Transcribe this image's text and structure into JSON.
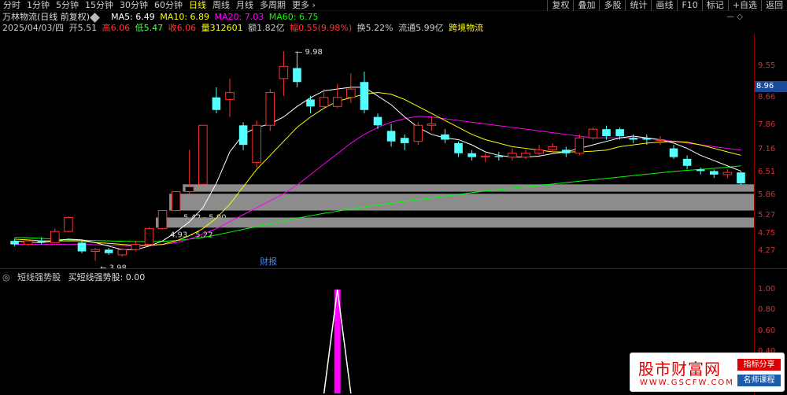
{
  "toolbar": {
    "periods": [
      "分时",
      "1分钟",
      "5分钟",
      "15分钟",
      "30分钟",
      "60分钟",
      "日线",
      "周线",
      "月线",
      "多周期",
      "更多"
    ],
    "active_period": "日线",
    "buttons": [
      "复权",
      "叠加",
      "多股",
      "统计",
      "画线",
      "F10",
      "标记",
      "+自选",
      "返回"
    ]
  },
  "stock": {
    "name": "万林物流(日线 前复权)",
    "ma5": "MA5: 6.49",
    "ma10": "MA10: 6.89",
    "ma20": "MA20: 7.03",
    "ma60": "MA60: 6.75",
    "date": "2025/04/03/四",
    "open": "开5.51",
    "high": "高6.06",
    "low": "低5.47",
    "close": "收6.06",
    "volume": "量312601",
    "amount": "额1.82亿",
    "change": "幅0.55(9.98%)",
    "turnover": "换5.22%",
    "float_cap": "流通5.99亿",
    "concept": "跨境物流"
  },
  "colors": {
    "up": "#ff3232",
    "down": "#54ffff",
    "ma5": "#ffffff",
    "ma10": "#ffff00",
    "ma20": "#ff00ff",
    "ma60": "#00ff00",
    "axis": "#cc3333",
    "gray_band": "#8c8c8c",
    "indicator_bar": "#ff00ff",
    "indicator_line": "#ffffff",
    "current_price_bg": "#1a4a9a"
  },
  "price_axis": {
    "ticks": [
      "9.55",
      "8.66",
      "7.86",
      "7.16",
      "6.51",
      "5.86",
      "5.27",
      "4.75",
      "4.27"
    ],
    "current": "8.96"
  },
  "annotations": {
    "high_label": "9.98",
    "low_label": "3.98",
    "event_label": "财报",
    "band1": "5.96 - 6.17",
    "band2": "5.42 - 5.90",
    "band3": "4.93 - 5.22"
  },
  "indicator": {
    "name": "短线强势股",
    "formula": "买短线强势股: 0.00",
    "ticks": [
      "1.00",
      "0.80",
      "0.60",
      "0.40",
      "0.20"
    ]
  },
  "watermark": {
    "title": "股市财富网",
    "url": "WWW.GSCFW.COM",
    "badge1": "指标分享",
    "badge2": "名师课程"
  },
  "chart_data": {
    "type": "candlestick",
    "price_range": [
      3.9,
      10.3
    ],
    "candles": [
      {
        "o": 4.55,
        "c": 4.45,
        "h": 4.62,
        "l": 4.4
      },
      {
        "o": 4.45,
        "c": 4.55,
        "h": 4.6,
        "l": 4.4
      },
      {
        "o": 4.55,
        "c": 4.5,
        "h": 4.65,
        "l": 4.45
      },
      {
        "o": 4.5,
        "c": 4.82,
        "h": 4.9,
        "l": 4.48
      },
      {
        "o": 4.82,
        "c": 5.22,
        "h": 5.25,
        "l": 4.8
      },
      {
        "o": 4.5,
        "c": 4.25,
        "h": 4.55,
        "l": 4.2
      },
      {
        "o": 4.25,
        "c": 4.3,
        "h": 4.35,
        "l": 3.98
      },
      {
        "o": 4.3,
        "c": 4.2,
        "h": 4.35,
        "l": 4.15
      },
      {
        "o": 4.15,
        "c": 4.3,
        "h": 4.35,
        "l": 4.1
      },
      {
        "o": 4.3,
        "c": 4.45,
        "h": 4.55,
        "l": 4.25
      },
      {
        "o": 4.45,
        "c": 4.9,
        "h": 4.95,
        "l": 4.4
      },
      {
        "o": 4.9,
        "c": 5.42,
        "h": 5.42,
        "l": 4.88
      },
      {
        "o": 5.42,
        "c": 5.96,
        "h": 5.96,
        "l": 5.4
      },
      {
        "o": 5.96,
        "c": 6.1,
        "h": 7.16,
        "l": 5.9
      },
      {
        "o": 6.17,
        "c": 7.86,
        "h": 7.86,
        "l": 6.15
      },
      {
        "o": 8.66,
        "c": 8.3,
        "h": 8.95,
        "l": 8.2
      },
      {
        "o": 8.6,
        "c": 8.8,
        "h": 9.2,
        "l": 8.1
      },
      {
        "o": 7.86,
        "c": 7.3,
        "h": 7.95,
        "l": 7.15
      },
      {
        "o": 6.8,
        "c": 7.86,
        "h": 8.0,
        "l": 6.65
      },
      {
        "o": 7.86,
        "c": 8.8,
        "h": 8.9,
        "l": 7.7
      },
      {
        "o": 9.2,
        "c": 9.55,
        "h": 9.98,
        "l": 8.7
      },
      {
        "o": 9.5,
        "c": 9.1,
        "h": 9.98,
        "l": 8.95
      },
      {
        "o": 8.6,
        "c": 8.4,
        "h": 8.7,
        "l": 8.2
      },
      {
        "o": 8.4,
        "c": 8.66,
        "h": 8.9,
        "l": 8.35
      },
      {
        "o": 8.4,
        "c": 8.66,
        "h": 9.05,
        "l": 8.35
      },
      {
        "o": 8.66,
        "c": 8.9,
        "h": 9.35,
        "l": 8.5
      },
      {
        "o": 9.1,
        "c": 8.3,
        "h": 9.4,
        "l": 8.2
      },
      {
        "o": 8.1,
        "c": 7.86,
        "h": 8.2,
        "l": 7.75
      },
      {
        "o": 7.7,
        "c": 7.4,
        "h": 7.9,
        "l": 7.25
      },
      {
        "o": 7.5,
        "c": 7.35,
        "h": 7.6,
        "l": 7.15
      },
      {
        "o": 7.4,
        "c": 7.86,
        "h": 7.95,
        "l": 7.3
      },
      {
        "o": 7.86,
        "c": 7.9,
        "h": 8.1,
        "l": 7.7
      },
      {
        "o": 7.6,
        "c": 7.45,
        "h": 7.75,
        "l": 7.35
      },
      {
        "o": 7.35,
        "c": 7.06,
        "h": 7.4,
        "l": 6.95
      },
      {
        "o": 7.06,
        "c": 6.95,
        "h": 7.15,
        "l": 6.85
      },
      {
        "o": 6.95,
        "c": 6.98,
        "h": 7.06,
        "l": 6.8
      },
      {
        "o": 6.98,
        "c": 6.95,
        "h": 7.1,
        "l": 6.85
      },
      {
        "o": 6.95,
        "c": 7.06,
        "h": 7.2,
        "l": 6.85
      },
      {
        "o": 6.95,
        "c": 7.06,
        "h": 7.16,
        "l": 6.9
      },
      {
        "o": 7.06,
        "c": 7.16,
        "h": 7.3,
        "l": 7.0
      },
      {
        "o": 7.16,
        "c": 7.25,
        "h": 7.35,
        "l": 7.1
      },
      {
        "o": 7.16,
        "c": 7.06,
        "h": 7.25,
        "l": 6.95
      },
      {
        "o": 7.06,
        "c": 7.5,
        "h": 7.6,
        "l": 7.0
      },
      {
        "o": 7.5,
        "c": 7.75,
        "h": 7.8,
        "l": 7.45
      },
      {
        "o": 7.75,
        "c": 7.55,
        "h": 7.85,
        "l": 7.45
      },
      {
        "o": 7.75,
        "c": 7.55,
        "h": 7.8,
        "l": 7.45
      },
      {
        "o": 7.5,
        "c": 7.45,
        "h": 7.6,
        "l": 7.35
      },
      {
        "o": 7.5,
        "c": 7.45,
        "h": 7.6,
        "l": 7.3
      },
      {
        "o": 7.45,
        "c": 7.45,
        "h": 7.55,
        "l": 7.3
      },
      {
        "o": 7.2,
        "c": 6.95,
        "h": 7.3,
        "l": 6.9
      },
      {
        "o": 6.9,
        "c": 6.7,
        "h": 7.0,
        "l": 6.6
      },
      {
        "o": 6.6,
        "c": 6.55,
        "h": 6.65,
        "l": 6.45
      },
      {
        "o": 6.55,
        "c": 6.45,
        "h": 6.6,
        "l": 6.35
      },
      {
        "o": 6.45,
        "c": 6.51,
        "h": 6.6,
        "l": 6.35
      },
      {
        "o": 6.51,
        "c": 6.2,
        "h": 6.55,
        "l": 6.15
      }
    ],
    "ma5": [
      4.55,
      4.52,
      4.5,
      4.55,
      4.6,
      4.58,
      4.5,
      4.4,
      4.3,
      4.3,
      4.4,
      4.55,
      4.8,
      5.1,
      5.5,
      6.2,
      7.1,
      7.6,
      7.8,
      7.9,
      8.1,
      8.4,
      8.65,
      8.85,
      8.9,
      8.95,
      8.95,
      8.7,
      8.45,
      8.1,
      7.8,
      7.6,
      7.5,
      7.45,
      7.3,
      7.1,
      7.0,
      6.95,
      6.95,
      6.98,
      7.05,
      7.1,
      7.2,
      7.3,
      7.4,
      7.5,
      7.55,
      7.5,
      7.45,
      7.35,
      7.2,
      7.0,
      6.85,
      6.7,
      6.55
    ],
    "ma10": [
      4.6,
      4.58,
      4.55,
      4.55,
      4.55,
      4.55,
      4.5,
      4.48,
      4.45,
      4.42,
      4.42,
      4.45,
      4.55,
      4.7,
      4.9,
      5.2,
      5.6,
      6.1,
      6.6,
      7.0,
      7.4,
      7.8,
      8.1,
      8.35,
      8.55,
      8.65,
      8.75,
      8.8,
      8.75,
      8.6,
      8.4,
      8.2,
      8.0,
      7.8,
      7.6,
      7.45,
      7.35,
      7.25,
      7.2,
      7.15,
      7.1,
      7.1,
      7.1,
      7.12,
      7.15,
      7.25,
      7.3,
      7.35,
      7.38,
      7.4,
      7.38,
      7.3,
      7.2,
      7.1,
      7.0
    ],
    "ma20": [
      4.45,
      4.45,
      4.45,
      4.45,
      4.45,
      4.45,
      4.44,
      4.43,
      4.42,
      4.41,
      4.42,
      4.45,
      4.5,
      4.6,
      4.75,
      4.9,
      5.1,
      5.3,
      5.5,
      5.7,
      5.9,
      6.15,
      6.45,
      6.75,
      7.05,
      7.35,
      7.6,
      7.8,
      7.95,
      8.05,
      8.12,
      8.1,
      8.05,
      8.0,
      7.95,
      7.9,
      7.85,
      7.8,
      7.75,
      7.7,
      7.65,
      7.6,
      7.55,
      7.5,
      7.5,
      7.5,
      7.5,
      7.48,
      7.45,
      7.4,
      7.35,
      7.3,
      7.25,
      7.2,
      7.15
    ],
    "ma60": [
      4.65,
      4.64,
      4.62,
      4.6,
      4.58,
      4.57,
      4.56,
      4.55,
      4.54,
      4.53,
      4.53,
      4.54,
      4.56,
      4.6,
      4.65,
      4.72,
      4.8,
      4.88,
      4.96,
      5.04,
      5.12,
      5.2,
      5.27,
      5.34,
      5.4,
      5.46,
      5.52,
      5.58,
      5.63,
      5.68,
      5.73,
      5.78,
      5.83,
      5.88,
      5.93,
      5.98,
      6.02,
      6.06,
      6.1,
      6.14,
      6.18,
      6.22,
      6.26,
      6.3,
      6.34,
      6.38,
      6.42,
      6.46,
      6.5,
      6.54,
      6.57,
      6.6,
      6.63,
      6.66,
      6.7
    ],
    "indicator_values": [
      0,
      0,
      0,
      0,
      0,
      0,
      0,
      0,
      0,
      0,
      0,
      0,
      0,
      0,
      0,
      0,
      0,
      0,
      0,
      0,
      0,
      0,
      0,
      0,
      0,
      0,
      0,
      0,
      0,
      0,
      0,
      0,
      0,
      0,
      0,
      0,
      0,
      0,
      0,
      0,
      0,
      0,
      0,
      0,
      0,
      0,
      0,
      0,
      0,
      0,
      0,
      0,
      0,
      0,
      0
    ],
    "indicator_signal_index": 24,
    "indicator_signal_value": 1.0
  }
}
